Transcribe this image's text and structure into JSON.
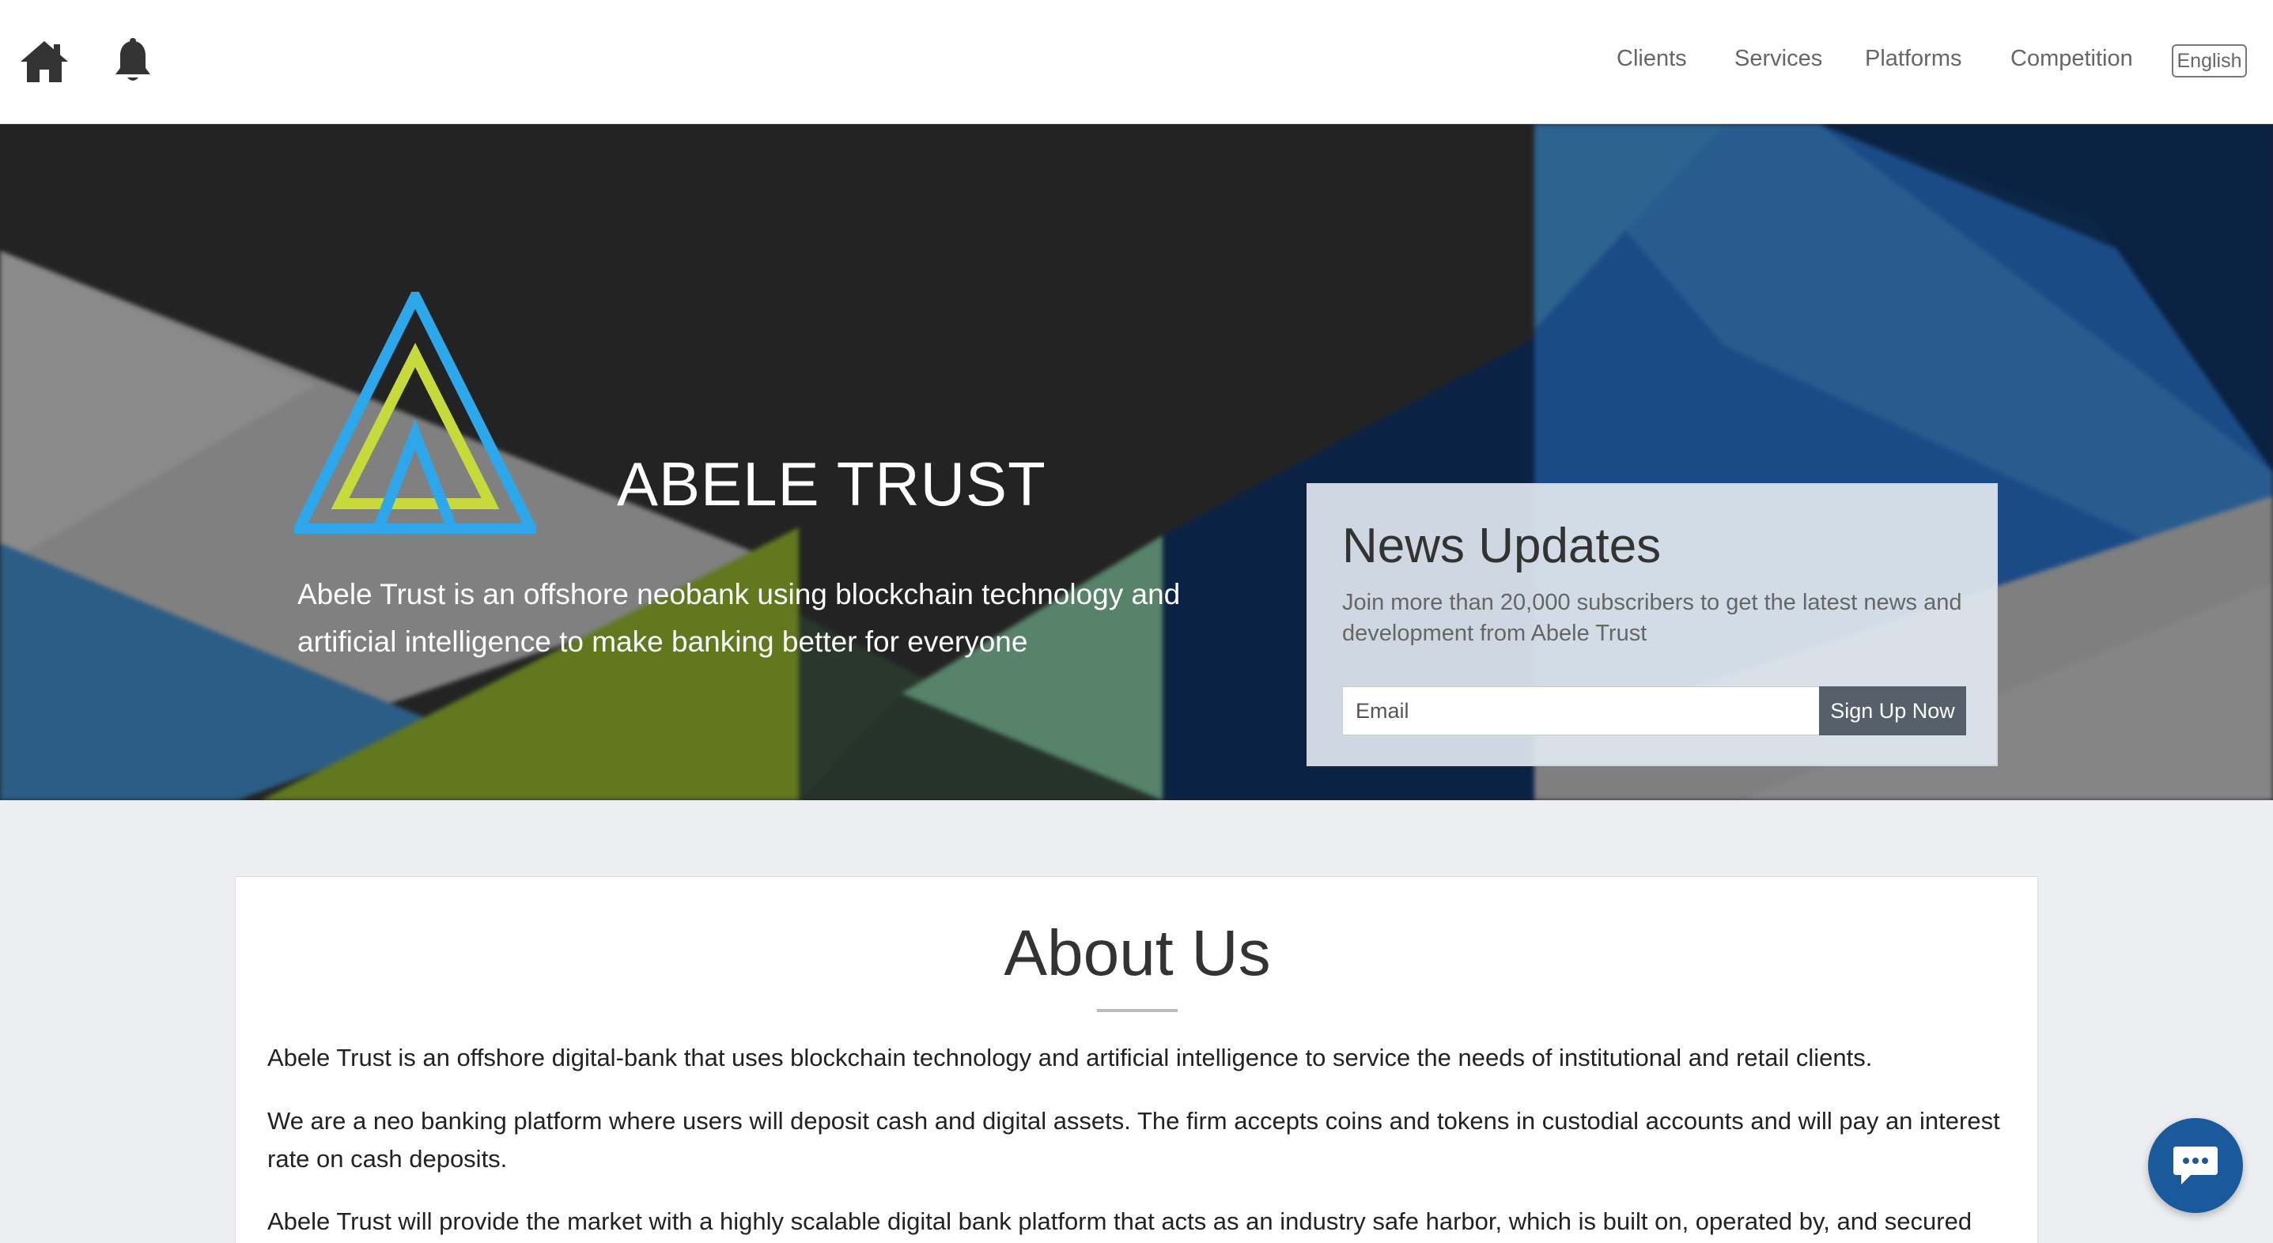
{
  "header": {
    "nav": [
      {
        "label": "Clients"
      },
      {
        "label": "Services"
      },
      {
        "label": "Platforms"
      },
      {
        "label": "Competition"
      }
    ],
    "language": "English"
  },
  "hero": {
    "brand": "ABELE TRUST",
    "tagline": "Abele Trust is an offshore neobank using blockchain technology and artificial intelligence to make banking better for everyone"
  },
  "news": {
    "title": "News Updates",
    "subtitle": "Join more than 20,000 subscribers to get the latest news and development from Abele Trust",
    "email_placeholder": "Email",
    "button": "Sign Up Now"
  },
  "about": {
    "title": "About Us",
    "paragraphs": [
      "Abele Trust is an offshore digital-bank that uses blockchain technology and artificial intelligence to service the needs of institutional and retail clients.",
      "We are a neo banking platform where users will deposit cash and digital assets. The firm accepts coins and tokens in custodial accounts and will pay an interest rate on cash deposits.",
      "Abele Trust will provide the market with a highly scalable digital bank platform that acts as an industry safe harbor, which is built on, operated by, and secured with"
    ]
  },
  "icons": {
    "home": "home-icon",
    "bell": "bell-icon",
    "chat": "chat-icon"
  },
  "colors": {
    "hero_dark": "#232323",
    "hero_blue": "#1b4b86",
    "logo_blue": "#2ea6ea",
    "logo_yellow": "#c8d93c",
    "button_gray": "#55606a",
    "chat_blue": "#1a5a9c"
  }
}
